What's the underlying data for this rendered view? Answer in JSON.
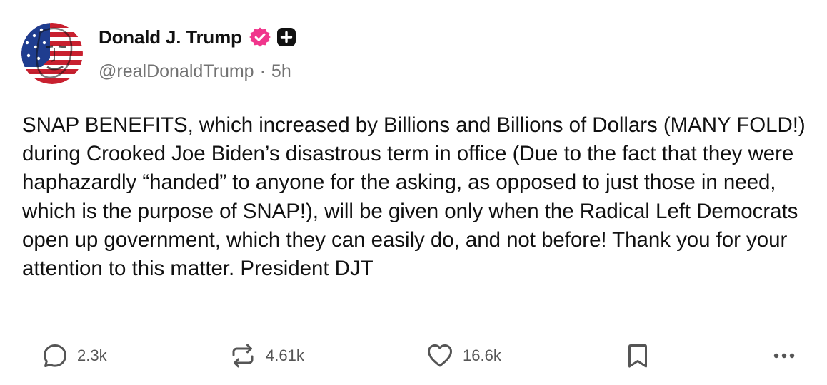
{
  "author": {
    "display_name": "Donald J. Trump",
    "handle": "@realDonaldTrump",
    "separator": "·",
    "time_ago": "5h",
    "avatar_icon": "american-flag-portrait-avatar",
    "verified_icon": "verified-badge-icon",
    "verified_color": "#f0368c",
    "extra_badge_icon": "plus-badge-icon"
  },
  "post": {
    "body": "SNAP BENEFITS, which increased by Billions and Billions of Dollars (MANY FOLD!) during Crooked Joe Biden’s disastrous term in office (Due to the fact that they were haphazardly “handed” to anyone for the asking, as opposed to just those in need, which is the purpose of SNAP!), will be given only when the Radical Left Democrats open up government, which they can easily do, and not before! Thank you for your attention to this matter. President DJT"
  },
  "actions": {
    "replies": {
      "icon": "comment-icon",
      "count": "2.3k"
    },
    "reposts": {
      "icon": "repost-icon",
      "count": "4.61k"
    },
    "likes": {
      "icon": "heart-icon",
      "count": "16.6k"
    },
    "bookmark": {
      "icon": "bookmark-icon"
    },
    "more": {
      "icon": "more-dots-icon"
    }
  }
}
